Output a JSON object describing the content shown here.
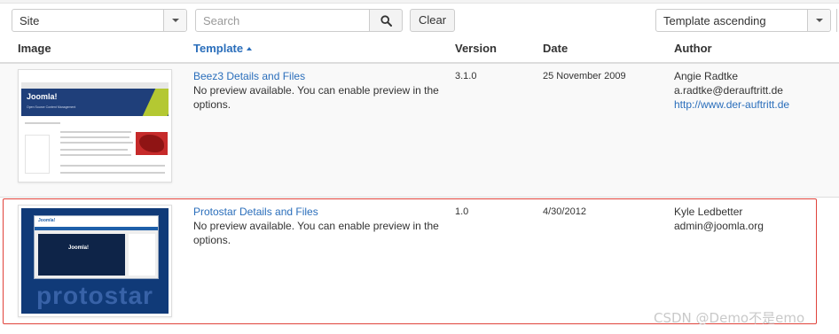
{
  "toolbar": {
    "site_select_value": "Site",
    "search_placeholder": "Search",
    "search_value": "",
    "clear_label": "Clear",
    "sort_select_value": "Template ascending"
  },
  "table": {
    "headers": {
      "image": "Image",
      "template": "Template",
      "version": "Version",
      "date": "Date",
      "author": "Author"
    },
    "sort_indicator": "ascending",
    "rows": [
      {
        "template_link": "Beez3 Details and Files",
        "description": "No preview available. You can enable preview in the options.",
        "version": "3.1.0",
        "date": "25 November 2009",
        "author_name": "Angie Radtke",
        "author_email": "a.radtke@derauftritt.de",
        "author_url": "http://www.der-auftritt.de",
        "thumbnail": {
          "logo_text": "Joomla!",
          "tagline": "Open Source Content Management"
        }
      },
      {
        "template_link": "Protostar Details and Files",
        "description": "No preview available. You can enable preview in the options.",
        "version": "1.0",
        "date": "4/30/2012",
        "author_name": "Kyle Ledbetter",
        "author_email": "admin@joomla.org",
        "author_url": "",
        "selected": true,
        "thumbnail": {
          "logo_text": "Joomla!",
          "hero_text": "Joomla!",
          "caption": "protostar"
        }
      }
    ]
  },
  "watermark": "CSDN @Demo不是emo",
  "colors": {
    "link": "#2a6ebb",
    "selection_border": "#e0433b",
    "row_stripe": "#f9f9f9"
  },
  "icons": {
    "search_button": "search-icon",
    "select_caret": "caret-down-icon",
    "sort_arrow": "sort-up-icon"
  }
}
